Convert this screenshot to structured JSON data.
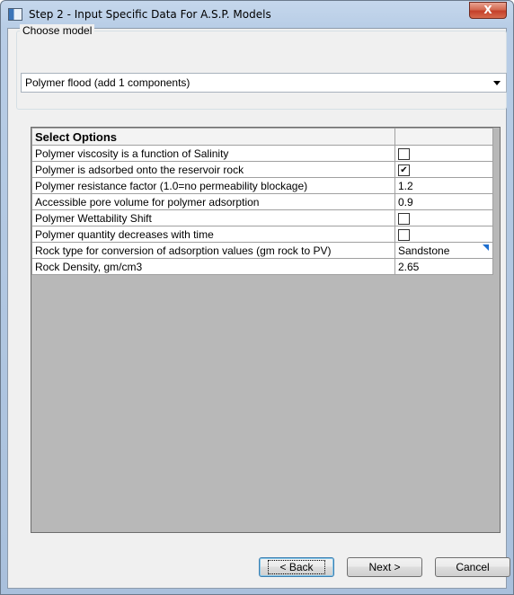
{
  "window": {
    "title": "Step 2 - Input Specific Data For A.S.P. Models",
    "close_glyph": "X"
  },
  "model": {
    "group_label": "Choose model",
    "selected": "Polymer flood (add 1 components)"
  },
  "grid": {
    "header": "Select Options",
    "rows": [
      {
        "label": "Polymer viscosity is a function of Salinity",
        "type": "checkbox",
        "checked": false,
        "value": ""
      },
      {
        "label": "Polymer is adsorbed onto the reservoir rock",
        "type": "checkbox",
        "checked": true,
        "value": "✔"
      },
      {
        "label": "Polymer resistance factor (1.0=no permeability blockage)",
        "type": "text",
        "value": "1.2"
      },
      {
        "label": "Accessible pore volume for polymer adsorption",
        "type": "text",
        "value": "0.9"
      },
      {
        "label": "Polymer Wettability Shift",
        "type": "checkbox",
        "checked": false,
        "value": ""
      },
      {
        "label": "Polymer quantity decreases with time",
        "type": "checkbox",
        "checked": false,
        "value": ""
      },
      {
        "label": "Rock type for conversion of adsorption values (gm rock to PV)",
        "type": "dropdown",
        "value": "Sandstone"
      },
      {
        "label": "Rock Density, gm/cm3",
        "type": "text",
        "value": "2.65"
      }
    ]
  },
  "buttons": {
    "back": "< Back",
    "next": "Next >",
    "cancel": "Cancel"
  },
  "colors": {
    "frame": "#b8cde6",
    "close": "#c4402a",
    "dropdown_marker": "#1e6fd0"
  }
}
